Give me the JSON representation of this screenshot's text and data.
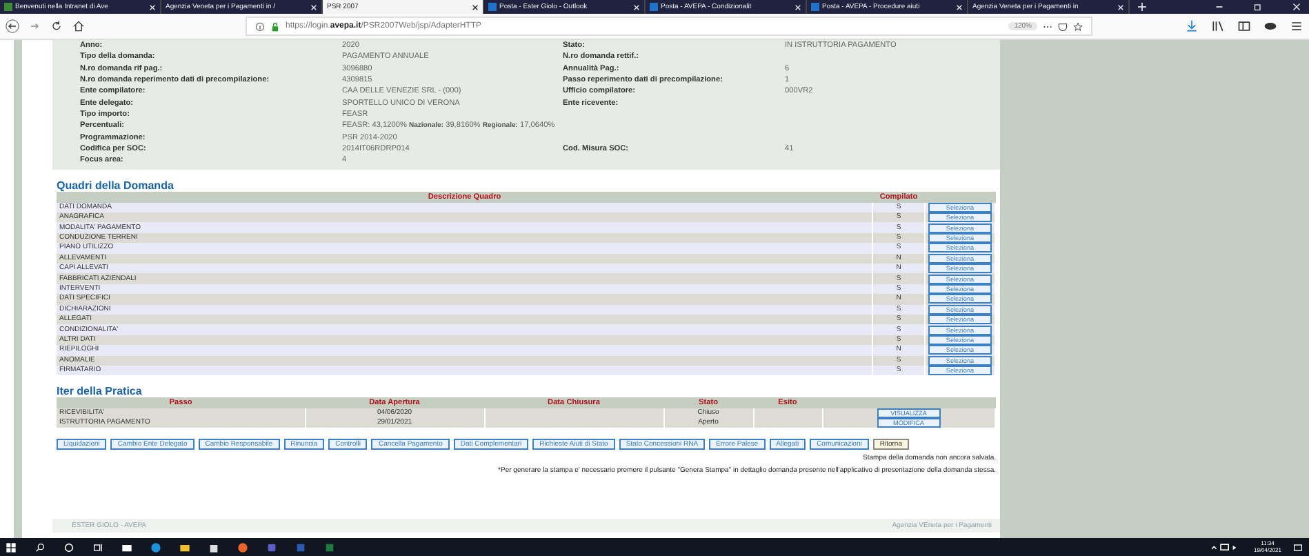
{
  "browser": {
    "tabs": [
      {
        "title": "Benvenuti nella Intranet di Ave",
        "kind": "intranet",
        "selected": false
      },
      {
        "title": "Agenzia Veneta per i Pagamenti in /",
        "kind": "plain",
        "selected": false
      },
      {
        "title": "PSR 2007",
        "kind": "plain",
        "selected": true
      },
      {
        "title": "Posta - Ester Giolo - Outlook",
        "kind": "mail",
        "selected": false
      },
      {
        "title": "Posta - AVEPA - Condizionalit",
        "kind": "mail",
        "selected": false
      },
      {
        "title": "Posta - AVEPA - Procedure aiuti",
        "kind": "mail",
        "selected": false
      },
      {
        "title": "Agenzia Veneta per i Pagamenti in",
        "kind": "plain",
        "selected": false
      }
    ],
    "url": "https://login.**avepa.it**/PSR2007Web/jsp/AdapterHTTP",
    "zoom": "120%"
  },
  "info": [
    {
      "label": "Anno:",
      "value": "2020",
      "label2": "Stato:",
      "value2": "IN ISTRUTTORIA PAGAMENTO"
    },
    {
      "label": "Tipo della domanda:",
      "value": "PAGAMENTO ANNUALE",
      "label2": "N.ro domanda rettif.:"
    },
    {
      "label": "N.ro domanda rif pag.:",
      "value": "3096880",
      "label2": "Annualità Pag.:",
      "value2": "6"
    },
    {
      "label": "N.ro domanda reperimento dati di precompilazione:",
      "value": "4309815",
      "label2": "Passo reperimento dati di precompilazione:",
      "value2": "1"
    },
    {
      "label": "Ente compilatore:",
      "value": "CAA DELLE VENEZIE SRL - (000)",
      "label2": "Ufficio compilatore:",
      "value2": "000VR2"
    },
    {
      "label": "Ente delegato:",
      "value": "SPORTELLO UNICO DI VERONA",
      "label2": "Ente ricevente:"
    },
    {
      "label": "Tipo importo:",
      "value": "FEASR"
    },
    {
      "label": "Percentuali:",
      "value": "FEASR: 43,1200%    **Nazionale:** 39,8160%    **Regionale:** 17,0640%"
    },
    {
      "label": "Programmazione:",
      "value": "PSR 2014-2020"
    },
    {
      "label": "Codifica per SOC:",
      "value": "2014IT06RDRP014",
      "label2": "Cod. Misura SOC:",
      "value2": "41"
    },
    {
      "label": "Focus area:",
      "value": "4"
    }
  ],
  "quadri": {
    "title": "Quadri della Domanda",
    "columns": [
      "Descrizione Quadro",
      "Compilato"
    ],
    "rows": [
      {
        "name": "DATI DOMANDA",
        "compilato": "S",
        "action": "Seleziona"
      },
      {
        "name": "ANAGRAFICA",
        "compilato": "S",
        "action": "Seleziona"
      },
      {
        "name": "MODALITA' PAGAMENTO",
        "compilato": "S",
        "action": "Seleziona"
      },
      {
        "name": "CONDUZIONE TERRENI",
        "compilato": "S",
        "action": "Seleziona"
      },
      {
        "name": "PIANO UTILIZZO",
        "compilato": "S",
        "action": "Seleziona"
      },
      {
        "name": "ALLEVAMENTI",
        "compilato": "N",
        "action": "Seleziona"
      },
      {
        "name": "CAPI ALLEVATI",
        "compilato": "N",
        "action": "Seleziona"
      },
      {
        "name": "FABBRICATI AZIENDALI",
        "compilato": "S",
        "action": "Seleziona"
      },
      {
        "name": "INTERVENTI",
        "compilato": "S",
        "action": "Seleziona"
      },
      {
        "name": "DATI SPECIFICI",
        "compilato": "N",
        "action": "Seleziona"
      },
      {
        "name": "DICHIARAZIONI",
        "compilato": "S",
        "action": "Seleziona"
      },
      {
        "name": "ALLEGATI",
        "compilato": "S",
        "action": "Seleziona"
      },
      {
        "name": "CONDIZIONALITA'",
        "compilato": "S",
        "action": "Seleziona"
      },
      {
        "name": "ALTRI DATI",
        "compilato": "S",
        "action": "Seleziona"
      },
      {
        "name": "RIEPILOGHI",
        "compilato": "N",
        "action": "Seleziona"
      },
      {
        "name": "ANOMALIE",
        "compilato": "S",
        "action": "Seleziona"
      },
      {
        "name": "FIRMATARIO",
        "compilato": "S",
        "action": "Seleziona"
      }
    ]
  },
  "iter": {
    "title": "Iter della Pratica",
    "columns": [
      "Passo",
      "Data Apertura",
      "Data Chiusura",
      "Stato",
      "Esito"
    ],
    "rows": [
      {
        "passo": "RICEVIBILITA'",
        "apertura": "04/06/2020",
        "stato": "Chiuso",
        "action": "VISUALIZZA"
      },
      {
        "passo": "ISTRUTTORIA PAGAMENTO",
        "apertura": "29/01/2021",
        "stato": "Aperto",
        "action": "MODIFICA"
      }
    ]
  },
  "actions": [
    {
      "label": "Liquidazioni",
      "kind": "normal"
    },
    {
      "label": "Cambio Ente Delegato",
      "kind": "normal"
    },
    {
      "label": "Cambio Responsabile",
      "kind": "normal"
    },
    {
      "label": "Rinuncia",
      "kind": "normal"
    },
    {
      "label": "Controlli",
      "kind": "normal"
    },
    {
      "label": "Cancella Pagamento",
      "kind": "normal"
    },
    {
      "label": "Dati Complementari",
      "kind": "normal"
    },
    {
      "label": "Richieste Aiuti di Stato",
      "kind": "normal"
    },
    {
      "label": "Stato Concessioni RNA",
      "kind": "normal"
    },
    {
      "label": "Errore Palese",
      "kind": "normal"
    },
    {
      "label": "Allegati",
      "kind": "normal"
    },
    {
      "label": "Comunicazioni",
      "kind": "normal"
    },
    {
      "label": "Ritorna",
      "kind": "back"
    }
  ],
  "notes": [
    "Stampa della domanda non ancora salvata.",
    "*Per generare la stampa e' necessario premere il pulsante \"Genera Stampa\" in dettaglio domanda presente nell'applicativo di presentazione della domanda stessa."
  ],
  "footer": {
    "user": "ESTER GIOLO - AVEPA",
    "agency": "Agenzia VEneta per i Pagamenti"
  },
  "taskbar": {
    "time": "11:34",
    "date": "19/04/2021"
  }
}
